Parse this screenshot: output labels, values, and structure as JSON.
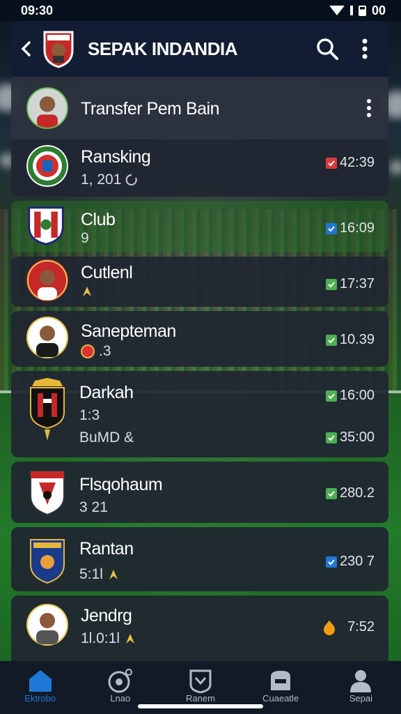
{
  "status_bar": {
    "time": "09:30",
    "battery_text": "00"
  },
  "app_bar": {
    "title": "SEPAK INDANDIA"
  },
  "items": [
    {
      "title": "Transfer Pem Bain",
      "sub": "",
      "right": ""
    },
    {
      "title": "Ransking",
      "sub": "1, 201",
      "right": "42:39",
      "badge": "red"
    },
    {
      "title": "Club",
      "sub": "9",
      "right": "16:09",
      "badge": "blue"
    },
    {
      "title": "Cutlenl",
      "sub": "",
      "right": "17:37",
      "badge": "green"
    },
    {
      "title": "Sanepteman",
      "sub": ".3",
      "right": "10.39",
      "badge": "green"
    },
    {
      "title": "Darkah",
      "sub": "1:3",
      "sub2": "BuMD &",
      "right": "16:00",
      "right2": "35:00",
      "badge": "green"
    },
    {
      "title": "Flsqohaum",
      "sub": "3 21",
      "right": "280.2",
      "badge": "green"
    },
    {
      "title": "Rantan",
      "sub": "5:1l",
      "right": "230 7",
      "badge": "blue"
    },
    {
      "title": "Jendrg",
      "sub": "1l.0:1l",
      "right": "7:52",
      "badge": "orange"
    }
  ],
  "tabs": [
    {
      "label": "Ektrobo",
      "icon": "home-icon"
    },
    {
      "label": "Lnao",
      "icon": "ball-icon"
    },
    {
      "label": "Ranem",
      "icon": "shield-icon"
    },
    {
      "label": "Cuaeatle",
      "icon": "chat-icon"
    },
    {
      "label": "Sepai",
      "icon": "profile-icon"
    }
  ],
  "colors": {
    "accent": "#1f78d6",
    "red": "#d93b3b",
    "green": "#4caf50",
    "blue": "#1f78d6",
    "orange": "#f39c12",
    "header": "#121d33"
  }
}
